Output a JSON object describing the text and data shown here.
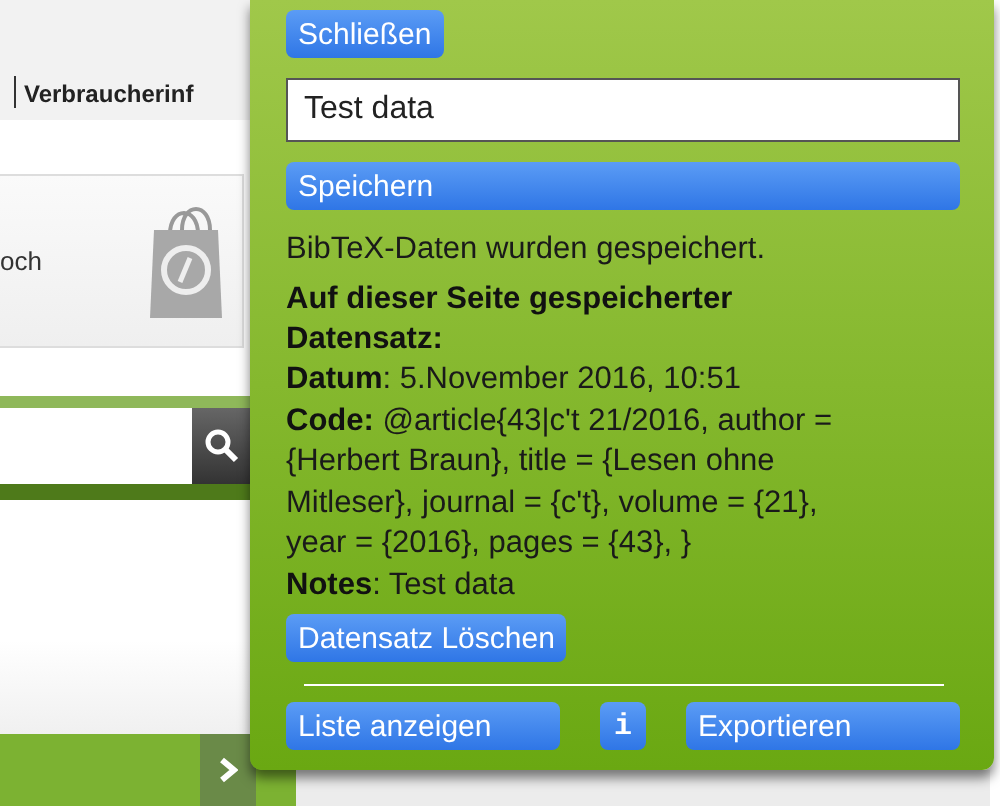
{
  "page": {
    "nav_text": "Verbraucherinf",
    "shop_text": "och"
  },
  "popup": {
    "close_button": "Schließen",
    "note_field": {
      "value": "Test data"
    },
    "save_button": "Speichern",
    "status": "BibTeX-Daten wurden gespeichert.",
    "heading": "Auf dieser Seite gespeicherter Datensatz:",
    "fields": [
      "**Datum**: 5.November 2016, 10:51",
      "**Code:** @article{43|c't 21/2016, author = {Herbert Braun}, title = {Lesen ohne Mitleser}, journal = {c't}, volume = {21}, year = {2016}, pages = {43}, }",
      "**Notes**: Test data"
    ],
    "delete_button": "Datensatz Löschen",
    "footer_buttons": [
      {
        "kind": "wide",
        "label": "Liste anzeigen"
      },
      {
        "kind": "info",
        "label": "i"
      },
      {
        "kind": "wide",
        "label": "Exportieren"
      }
    ]
  }
}
